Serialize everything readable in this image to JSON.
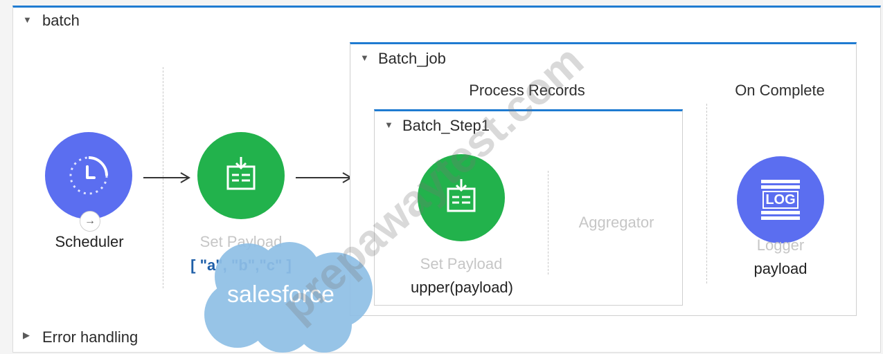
{
  "flow": {
    "name": "batch",
    "error_handling_label": "Error handling"
  },
  "scheduler": {
    "label": "Scheduler"
  },
  "set_payload_1": {
    "label": "Set Payload",
    "value": "[ \"a\", \"b\",\"c\" ]"
  },
  "batch_job": {
    "name": "Batch_job",
    "process_records_title": "Process Records",
    "on_complete_title": "On Complete",
    "step": {
      "name": "Batch_Step1",
      "processor": {
        "label": "Set Payload",
        "value": "upper(payload)"
      },
      "aggregator_label": "Aggregator"
    },
    "logger": {
      "label": "Logger",
      "value": "payload",
      "icon_text": "LOG"
    }
  },
  "watermark": {
    "cloud_text": "salesforce",
    "diagonal_text": "prepawaytest.com"
  },
  "colors": {
    "scheduler": "#5b6ef0",
    "set_payload": "#22b24c",
    "logger": "#5b6ef0",
    "accent_blue": "#1f7bd1",
    "cloud": "#8fbfe6"
  }
}
